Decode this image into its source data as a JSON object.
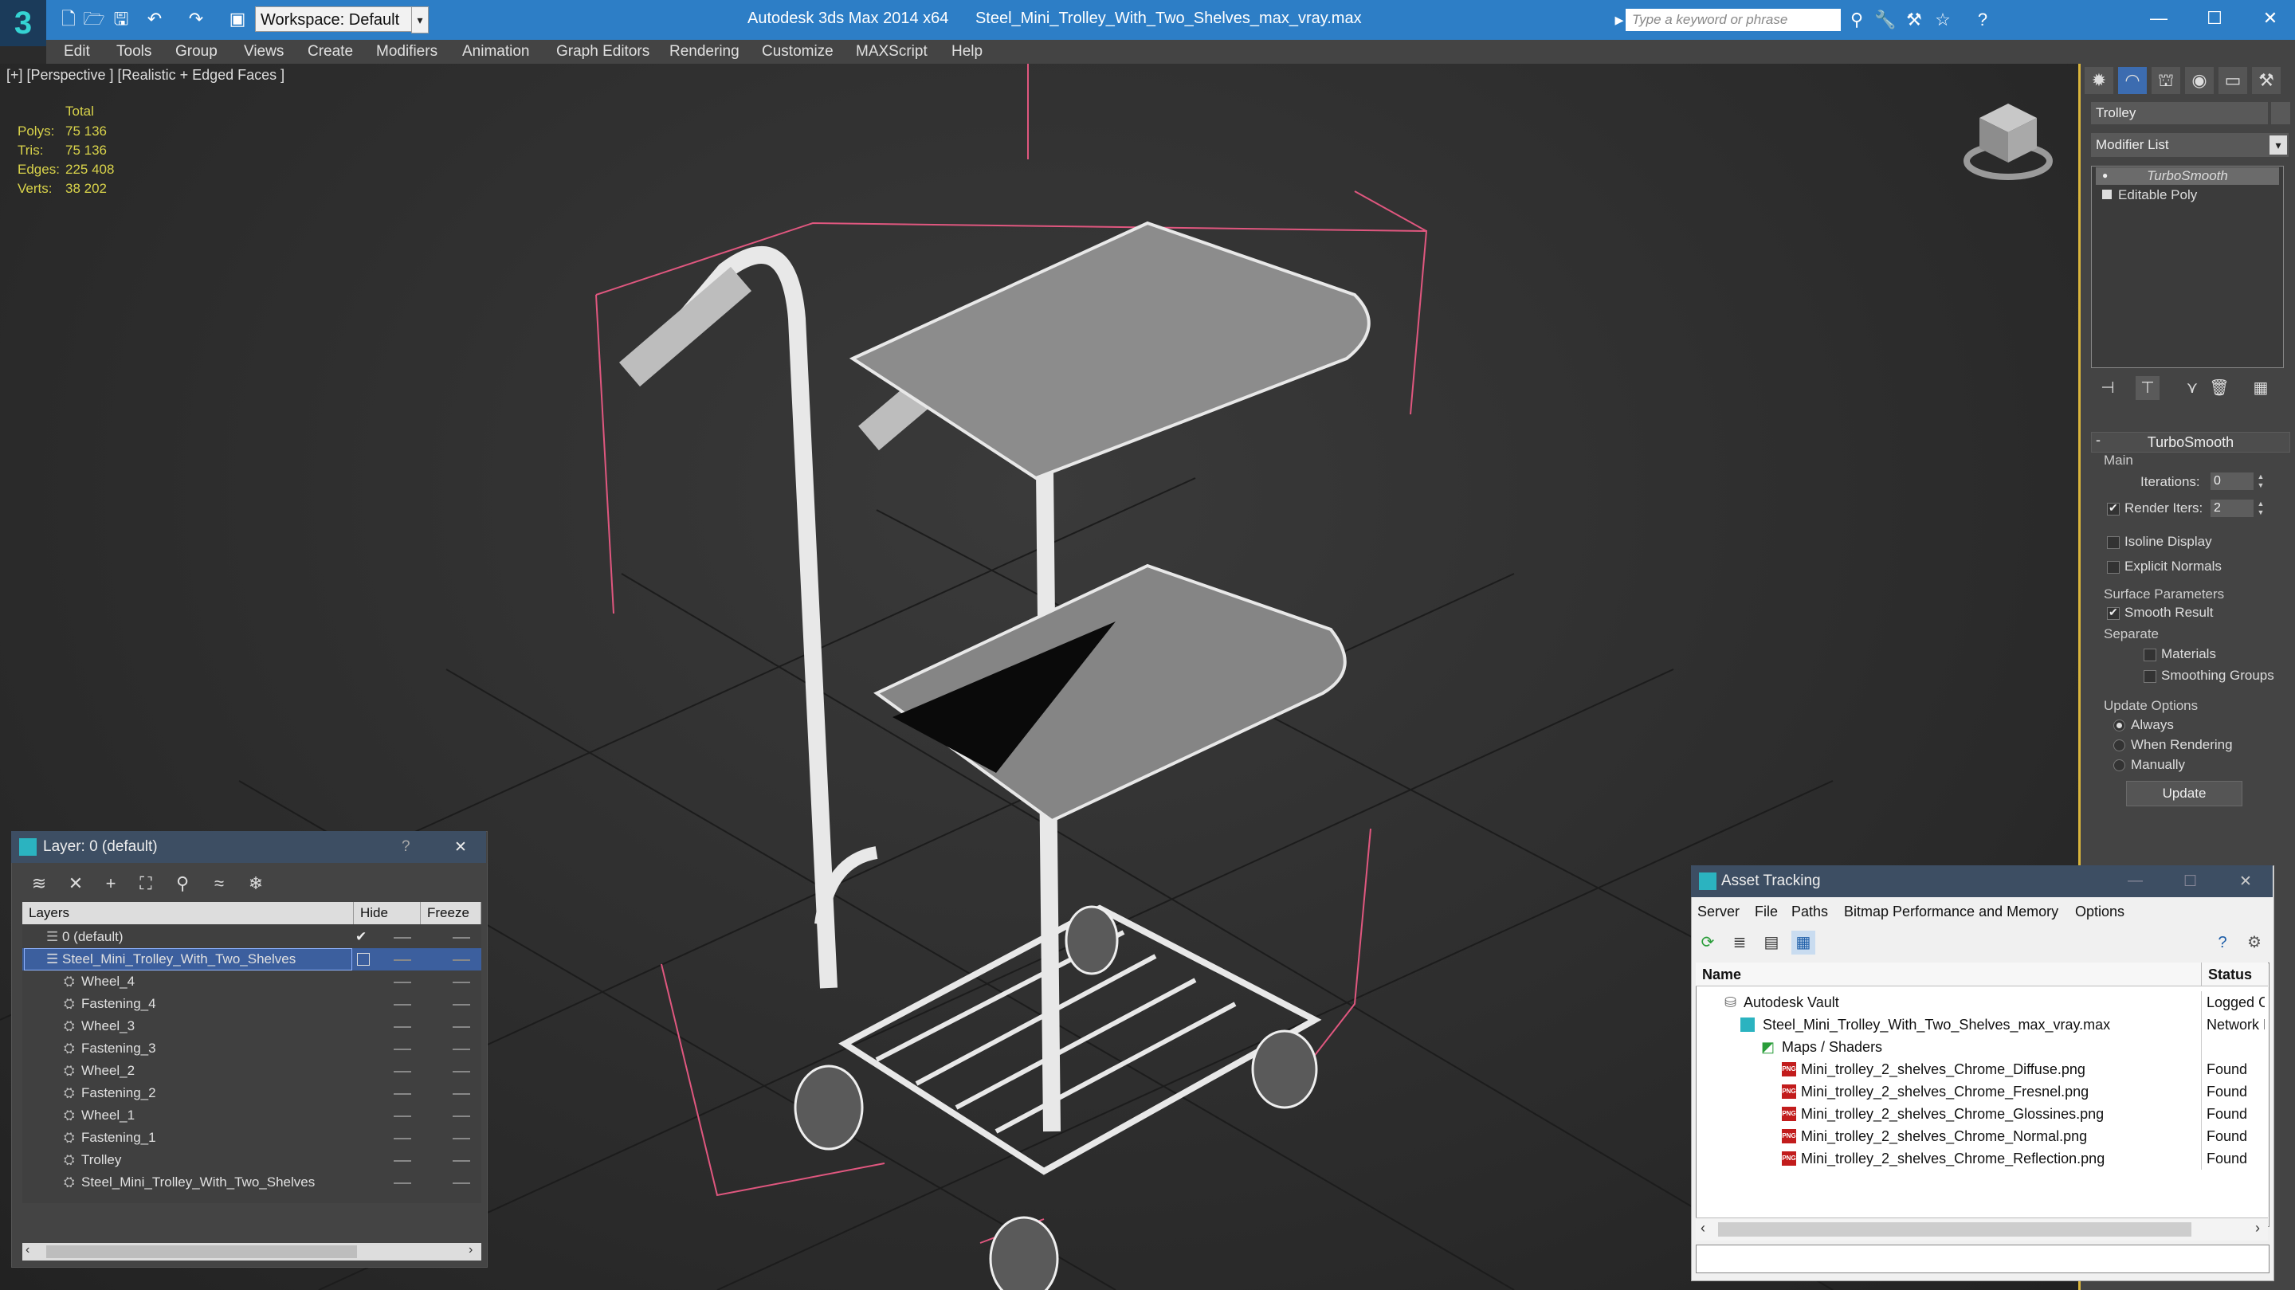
{
  "titlebar": {
    "app_title": "Autodesk 3ds Max  2014 x64",
    "file_title": "Steel_Mini_Trolley_With_Two_Shelves_max_vray.max",
    "workspace": "Workspace: Default",
    "search_placeholder": "Type a keyword or phrase",
    "accent": "#2d7ec6"
  },
  "menubar": {
    "items": [
      "Edit",
      "Tools",
      "Group",
      "Views",
      "Create",
      "Modifiers",
      "Animation",
      "Graph Editors",
      "Rendering",
      "Customize",
      "MAXScript",
      "Help"
    ]
  },
  "viewport": {
    "label": "[+] [Perspective ] [Realistic + Edged Faces ]",
    "stats": {
      "header": "Total",
      "rows": [
        {
          "label": "Polys:",
          "value": "75 136"
        },
        {
          "label": "Tris:",
          "value": "75 136"
        },
        {
          "label": "Edges:",
          "value": "225 408"
        },
        {
          "label": "Verts:",
          "value": "38 202"
        }
      ]
    }
  },
  "command_panel": {
    "object_name": "Trolley",
    "modifier_list": "Modifier List",
    "stack": [
      "TurboSmooth",
      "Editable Poly"
    ],
    "rollout_title": "TurboSmooth",
    "main_group": "Main",
    "iterations_label": "Iterations:",
    "iterations_value": "0",
    "render_iters_label": "Render Iters:",
    "render_iters_value": "2",
    "isoline_label": "Isoline Display",
    "explicit_normals_label": "Explicit Normals",
    "surface_group": "Surface Parameters",
    "smooth_result_label": "Smooth Result",
    "separate_label": "Separate",
    "materials_label": "Materials",
    "smoothing_groups_label": "Smoothing Groups",
    "update_group": "Update Options",
    "always_label": "Always",
    "when_rendering_label": "When Rendering",
    "manually_label": "Manually",
    "update_button": "Update"
  },
  "layer_dialog": {
    "title": "Layer: 0 (default)",
    "help": "?",
    "close": "✕",
    "columns": [
      "Layers",
      "Hide",
      "Freeze"
    ],
    "rows": [
      {
        "name": "0 (default)"
      },
      {
        "name": "Steel_Mini_Trolley_With_Two_Shelves"
      },
      {
        "name": "Wheel_4"
      },
      {
        "name": "Fastening_4"
      },
      {
        "name": "Wheel_3"
      },
      {
        "name": "Fastening_3"
      },
      {
        "name": "Wheel_2"
      },
      {
        "name": "Fastening_2"
      },
      {
        "name": "Wheel_1"
      },
      {
        "name": "Fastening_1"
      },
      {
        "name": "Trolley"
      },
      {
        "name": "Steel_Mini_Trolley_With_Two_Shelves"
      }
    ]
  },
  "asset_tracking": {
    "title": "Asset Tracking",
    "menu": [
      "Server",
      "File",
      "Paths",
      "Bitmap Performance and Memory",
      "Options"
    ],
    "columns": [
      "Name",
      "Status"
    ],
    "rows": [
      {
        "name": "Autodesk Vault",
        "status": "Logged Out"
      },
      {
        "name": "Steel_Mini_Trolley_With_Two_Shelves_max_vray.max",
        "status": "Network Path"
      },
      {
        "name": "Maps / Shaders",
        "status": ""
      },
      {
        "name": "Mini_trolley_2_shelves_Chrome_Diffuse.png",
        "status": "Found"
      },
      {
        "name": "Mini_trolley_2_shelves_Chrome_Fresnel.png",
        "status": "Found"
      },
      {
        "name": "Mini_trolley_2_shelves_Chrome_Glossines.png",
        "status": "Found"
      },
      {
        "name": "Mini_trolley_2_shelves_Chrome_Normal.png",
        "status": "Found"
      },
      {
        "name": "Mini_trolley_2_shelves_Chrome_Reflection.png",
        "status": "Found"
      }
    ]
  }
}
